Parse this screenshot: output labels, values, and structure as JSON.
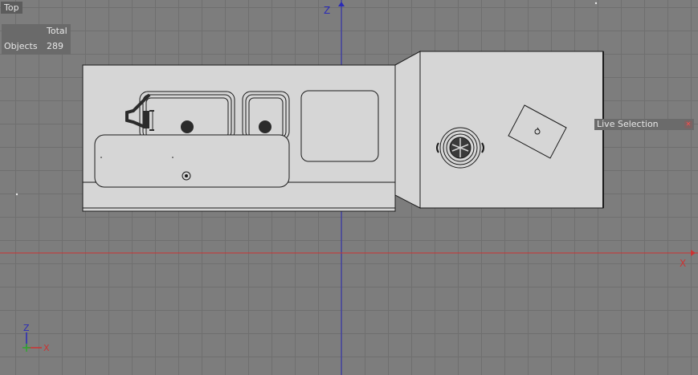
{
  "viewport": {
    "view_name": "Top",
    "axis_vertical_label": "Z",
    "axis_horizontal_label": "X"
  },
  "stats": {
    "header": "Total",
    "row_label": "Objects",
    "row_value": "289"
  },
  "hud": {
    "live_selection_label": "Live Selection",
    "close_icon": "close-icon"
  },
  "colors": {
    "background": "#7d7d7d",
    "grid": "#6f6f6f",
    "z_axis": "#2a2ab8",
    "x_axis": "#cc3333",
    "model_fill": "#d6d6d6",
    "model_stroke": "#1a1a1a"
  },
  "gizmo": {
    "up_label": "Z",
    "right_label": "X"
  }
}
